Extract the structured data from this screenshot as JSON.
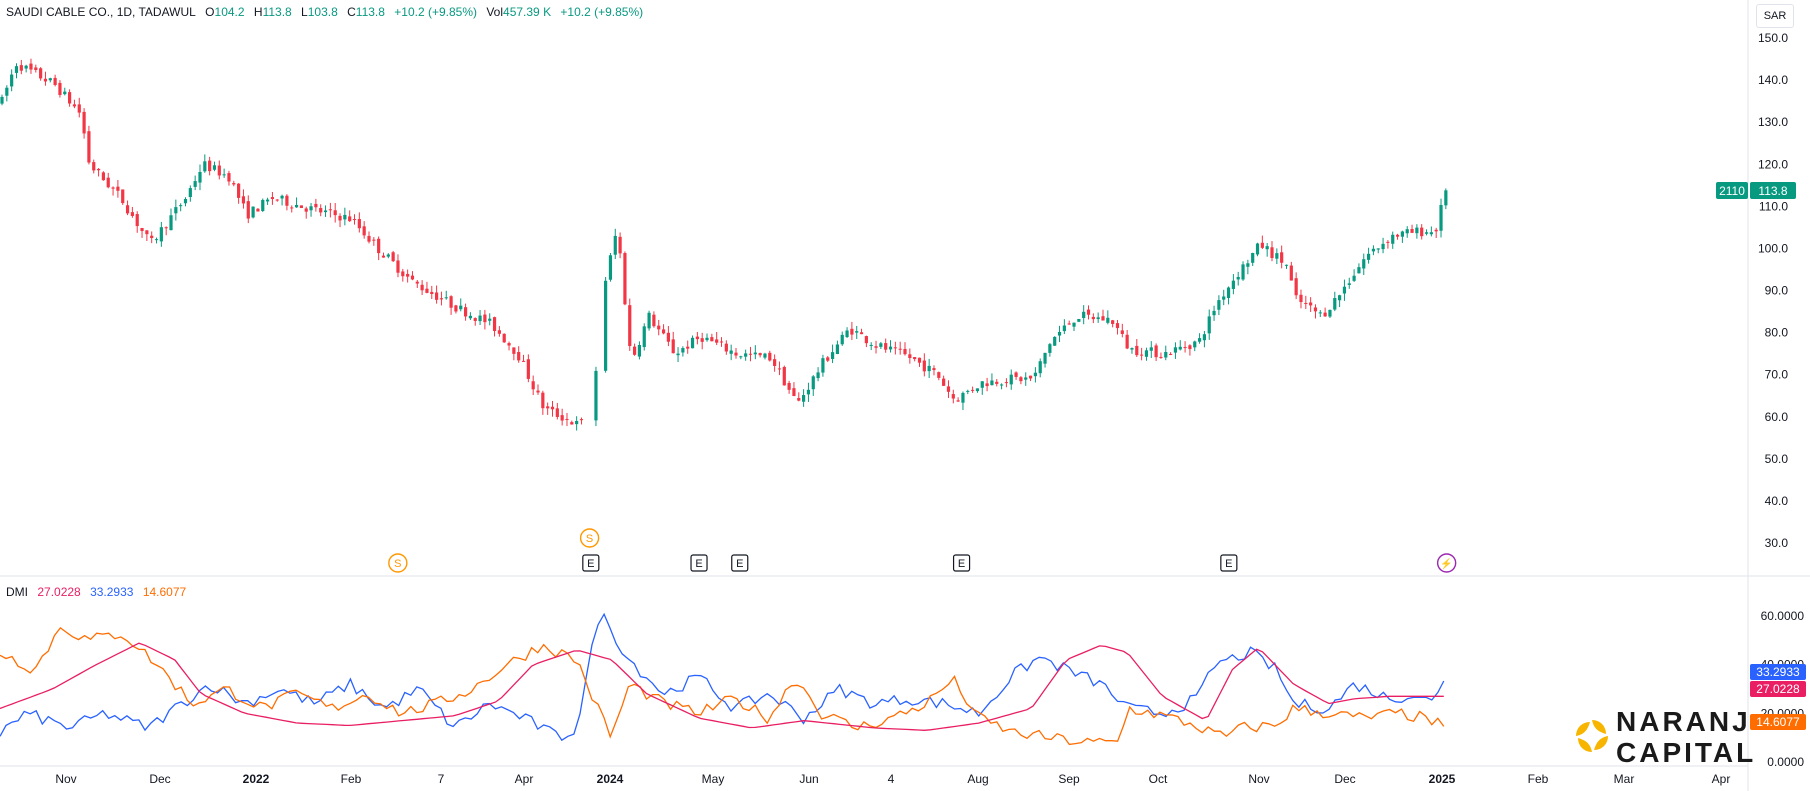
{
  "header": {
    "symbol": "SAUDI CABLE CO., 1D, TADAWUL",
    "open_label": "O",
    "open": "104.2",
    "high_label": "H",
    "high": "113.8",
    "low_label": "L",
    "low": "103.8",
    "close_label": "C",
    "close": "113.8",
    "change": "+10.2 (+9.85%)",
    "vol_label": "Vol",
    "vol": "457.39 K",
    "vol_change": "+10.2 (+9.85%)"
  },
  "currency_button": "SAR",
  "price_tag": {
    "left": "2110",
    "right": "113.8"
  },
  "dmi": {
    "title": "DMI",
    "adx": "27.0228",
    "plus_di": "33.2933",
    "minus_di": "14.6077",
    "adx_tag": "27.0228",
    "plus_tag": "33.2933",
    "minus_tag": "14.6077"
  },
  "logo": {
    "line1": "NARANJ",
    "line2": "CAPITAL"
  },
  "colors": {
    "up": "#089981",
    "down": "#f23645",
    "adx": "#e91e63",
    "plus_di": "#2962ff",
    "minus_di": "#ff6d00",
    "split": "#ff9800",
    "earnings": "#131722"
  },
  "chart_data": {
    "type": "candlestick",
    "price_axis": {
      "ylim": [
        25,
        155
      ],
      "ticks": [
        "150.0",
        "140.0",
        "130.0",
        "120.0",
        "110.0",
        "100.0",
        "90.0",
        "80.0",
        "70.0",
        "60.0",
        "50.0",
        "40.0",
        "30.0"
      ]
    },
    "dmi_axis": {
      "ylim": [
        0,
        65
      ],
      "ticks": [
        "60.0000",
        "40.0000",
        "20.0000",
        "0.0000"
      ]
    },
    "x_labels": [
      "Nov",
      "Dec",
      "2022",
      "Feb",
      "7",
      "Apr",
      "2024",
      "May",
      "Jun",
      "4",
      "Aug",
      "Sep",
      "Oct",
      "Nov",
      "Dec",
      "2025",
      "Feb",
      "Mar",
      "Apr"
    ],
    "x_bold": [
      "2022",
      "2024",
      "2025"
    ],
    "markers": [
      {
        "type": "split",
        "label": "S",
        "row": "low",
        "x_frac": 0.2276
      },
      {
        "type": "split",
        "label": "S",
        "row": "high",
        "x_frac": 0.3373
      },
      {
        "type": "earnings",
        "label": "E",
        "row": "low",
        "x_frac": 0.338
      },
      {
        "type": "earnings",
        "label": "E",
        "row": "low",
        "x_frac": 0.3999
      },
      {
        "type": "earnings",
        "label": "E",
        "row": "low",
        "x_frac": 0.4232
      },
      {
        "type": "earnings",
        "label": "E",
        "row": "low",
        "x_frac": 0.5501
      },
      {
        "type": "earnings",
        "label": "E",
        "row": "low",
        "x_frac": 0.703
      },
      {
        "type": "flash",
        "label": "⚡",
        "row": "low",
        "x_frac": 0.8276
      }
    ],
    "price_anchors": [
      [
        0,
        135
      ],
      [
        0.008,
        144
      ],
      [
        0.03,
        139
      ],
      [
        0.045,
        132
      ],
      [
        0.05,
        120
      ],
      [
        0.068,
        112
      ],
      [
        0.085,
        101
      ],
      [
        0.105,
        112
      ],
      [
        0.115,
        120
      ],
      [
        0.13,
        117
      ],
      [
        0.14,
        108
      ],
      [
        0.155,
        112
      ],
      [
        0.18,
        109
      ],
      [
        0.2,
        107
      ],
      [
        0.215,
        100
      ],
      [
        0.235,
        92
      ],
      [
        0.26,
        86
      ],
      [
        0.28,
        82
      ],
      [
        0.295,
        75
      ],
      [
        0.31,
        62
      ],
      [
        0.33,
        58
      ],
      [
        0.337,
        60
      ],
      [
        0.345,
        92
      ],
      [
        0.352,
        105
      ],
      [
        0.36,
        73
      ],
      [
        0.37,
        84
      ],
      [
        0.385,
        75
      ],
      [
        0.4,
        79
      ],
      [
        0.42,
        75
      ],
      [
        0.44,
        74
      ],
      [
        0.455,
        63
      ],
      [
        0.47,
        73
      ],
      [
        0.485,
        81
      ],
      [
        0.5,
        77
      ],
      [
        0.52,
        74
      ],
      [
        0.535,
        70
      ],
      [
        0.545,
        64
      ],
      [
        0.56,
        68
      ],
      [
        0.575,
        69
      ],
      [
        0.59,
        69
      ],
      [
        0.6,
        78
      ],
      [
        0.615,
        84
      ],
      [
        0.635,
        83
      ],
      [
        0.645,
        76
      ],
      [
        0.665,
        75
      ],
      [
        0.685,
        78
      ],
      [
        0.695,
        87
      ],
      [
        0.705,
        93
      ],
      [
        0.72,
        101
      ],
      [
        0.735,
        96
      ],
      [
        0.74,
        88
      ],
      [
        0.755,
        84
      ],
      [
        0.765,
        89
      ],
      [
        0.78,
        98
      ],
      [
        0.795,
        103
      ],
      [
        0.81,
        104
      ],
      [
        0.82,
        104
      ],
      [
        0.826,
        113.8
      ]
    ],
    "adx_anchors": [
      [
        0,
        22
      ],
      [
        0.03,
        30
      ],
      [
        0.055,
        40
      ],
      [
        0.08,
        49
      ],
      [
        0.1,
        42
      ],
      [
        0.115,
        28
      ],
      [
        0.14,
        20
      ],
      [
        0.17,
        16
      ],
      [
        0.2,
        15
      ],
      [
        0.23,
        17
      ],
      [
        0.26,
        19
      ],
      [
        0.285,
        25
      ],
      [
        0.305,
        40
      ],
      [
        0.33,
        46
      ],
      [
        0.35,
        42
      ],
      [
        0.37,
        28
      ],
      [
        0.4,
        18
      ],
      [
        0.43,
        14
      ],
      [
        0.46,
        17
      ],
      [
        0.5,
        14
      ],
      [
        0.53,
        13
      ],
      [
        0.56,
        16
      ],
      [
        0.59,
        22
      ],
      [
        0.61,
        42
      ],
      [
        0.63,
        48
      ],
      [
        0.645,
        45
      ],
      [
        0.665,
        27
      ],
      [
        0.69,
        17
      ],
      [
        0.705,
        38
      ],
      [
        0.72,
        47
      ],
      [
        0.74,
        32
      ],
      [
        0.76,
        24
      ],
      [
        0.775,
        26
      ],
      [
        0.795,
        27
      ],
      [
        0.826,
        27.02
      ]
    ],
    "plus_anchors": [
      [
        0,
        12
      ],
      [
        0.015,
        20
      ],
      [
        0.04,
        14
      ],
      [
        0.06,
        20
      ],
      [
        0.085,
        14
      ],
      [
        0.1,
        22
      ],
      [
        0.12,
        32
      ],
      [
        0.14,
        24
      ],
      [
        0.16,
        30
      ],
      [
        0.18,
        24
      ],
      [
        0.2,
        32
      ],
      [
        0.22,
        22
      ],
      [
        0.24,
        30
      ],
      [
        0.26,
        14
      ],
      [
        0.28,
        24
      ],
      [
        0.3,
        18
      ],
      [
        0.32,
        10
      ],
      [
        0.33,
        14
      ],
      [
        0.343,
        62
      ],
      [
        0.36,
        42
      ],
      [
        0.38,
        28
      ],
      [
        0.4,
        35
      ],
      [
        0.42,
        22
      ],
      [
        0.44,
        28
      ],
      [
        0.46,
        18
      ],
      [
        0.48,
        30
      ],
      [
        0.5,
        24
      ],
      [
        0.52,
        26
      ],
      [
        0.54,
        24
      ],
      [
        0.56,
        20
      ],
      [
        0.58,
        36
      ],
      [
        0.595,
        43
      ],
      [
        0.61,
        38
      ],
      [
        0.63,
        32
      ],
      [
        0.645,
        22
      ],
      [
        0.665,
        20
      ],
      [
        0.685,
        26
      ],
      [
        0.695,
        40
      ],
      [
        0.715,
        45
      ],
      [
        0.73,
        38
      ],
      [
        0.74,
        24
      ],
      [
        0.76,
        22
      ],
      [
        0.775,
        32
      ],
      [
        0.795,
        26
      ],
      [
        0.81,
        28
      ],
      [
        0.82,
        24
      ],
      [
        0.826,
        33.29
      ]
    ],
    "minus_anchors": [
      [
        0,
        45
      ],
      [
        0.02,
        38
      ],
      [
        0.035,
        56
      ],
      [
        0.05,
        50
      ],
      [
        0.07,
        53
      ],
      [
        0.09,
        40
      ],
      [
        0.11,
        24
      ],
      [
        0.13,
        30
      ],
      [
        0.15,
        22
      ],
      [
        0.17,
        28
      ],
      [
        0.19,
        22
      ],
      [
        0.21,
        28
      ],
      [
        0.23,
        20
      ],
      [
        0.25,
        24
      ],
      [
        0.27,
        30
      ],
      [
        0.29,
        40
      ],
      [
        0.31,
        48
      ],
      [
        0.33,
        42
      ],
      [
        0.34,
        25
      ],
      [
        0.35,
        10
      ],
      [
        0.36,
        32
      ],
      [
        0.38,
        24
      ],
      [
        0.4,
        20
      ],
      [
        0.42,
        26
      ],
      [
        0.44,
        18
      ],
      [
        0.455,
        35
      ],
      [
        0.47,
        20
      ],
      [
        0.49,
        14
      ],
      [
        0.51,
        18
      ],
      [
        0.53,
        24
      ],
      [
        0.545,
        34
      ],
      [
        0.56,
        18
      ],
      [
        0.58,
        12
      ],
      [
        0.6,
        10
      ],
      [
        0.62,
        8
      ],
      [
        0.64,
        8
      ],
      [
        0.645,
        22
      ],
      [
        0.66,
        20
      ],
      [
        0.68,
        16
      ],
      [
        0.7,
        10
      ],
      [
        0.71,
        14
      ],
      [
        0.73,
        15
      ],
      [
        0.74,
        22
      ],
      [
        0.76,
        20
      ],
      [
        0.78,
        18
      ],
      [
        0.8,
        20
      ],
      [
        0.815,
        18
      ],
      [
        0.826,
        14.61
      ]
    ]
  }
}
